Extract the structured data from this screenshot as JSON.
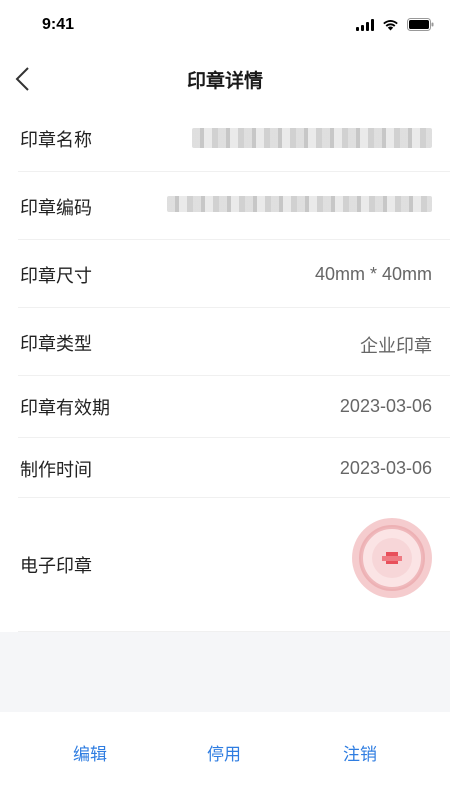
{
  "status_bar": {
    "time": "9:41"
  },
  "nav": {
    "title": "印章详情"
  },
  "rows": [
    {
      "label": "印章名称"
    },
    {
      "label": "印章编码"
    },
    {
      "label": "印章尺寸",
      "value": "40mm * 40mm"
    },
    {
      "label": "印章类型",
      "value": "企业印章"
    },
    {
      "label": "印章有效期",
      "value": "2023-03-06"
    },
    {
      "label": "制作时间",
      "value": "2023-03-06"
    },
    {
      "label": "电子印章"
    }
  ],
  "actions": {
    "edit": "编辑",
    "disable": "停用",
    "cancel": "注销"
  },
  "colors": {
    "accent": "#2f7de1",
    "seal": "#e8505b"
  }
}
